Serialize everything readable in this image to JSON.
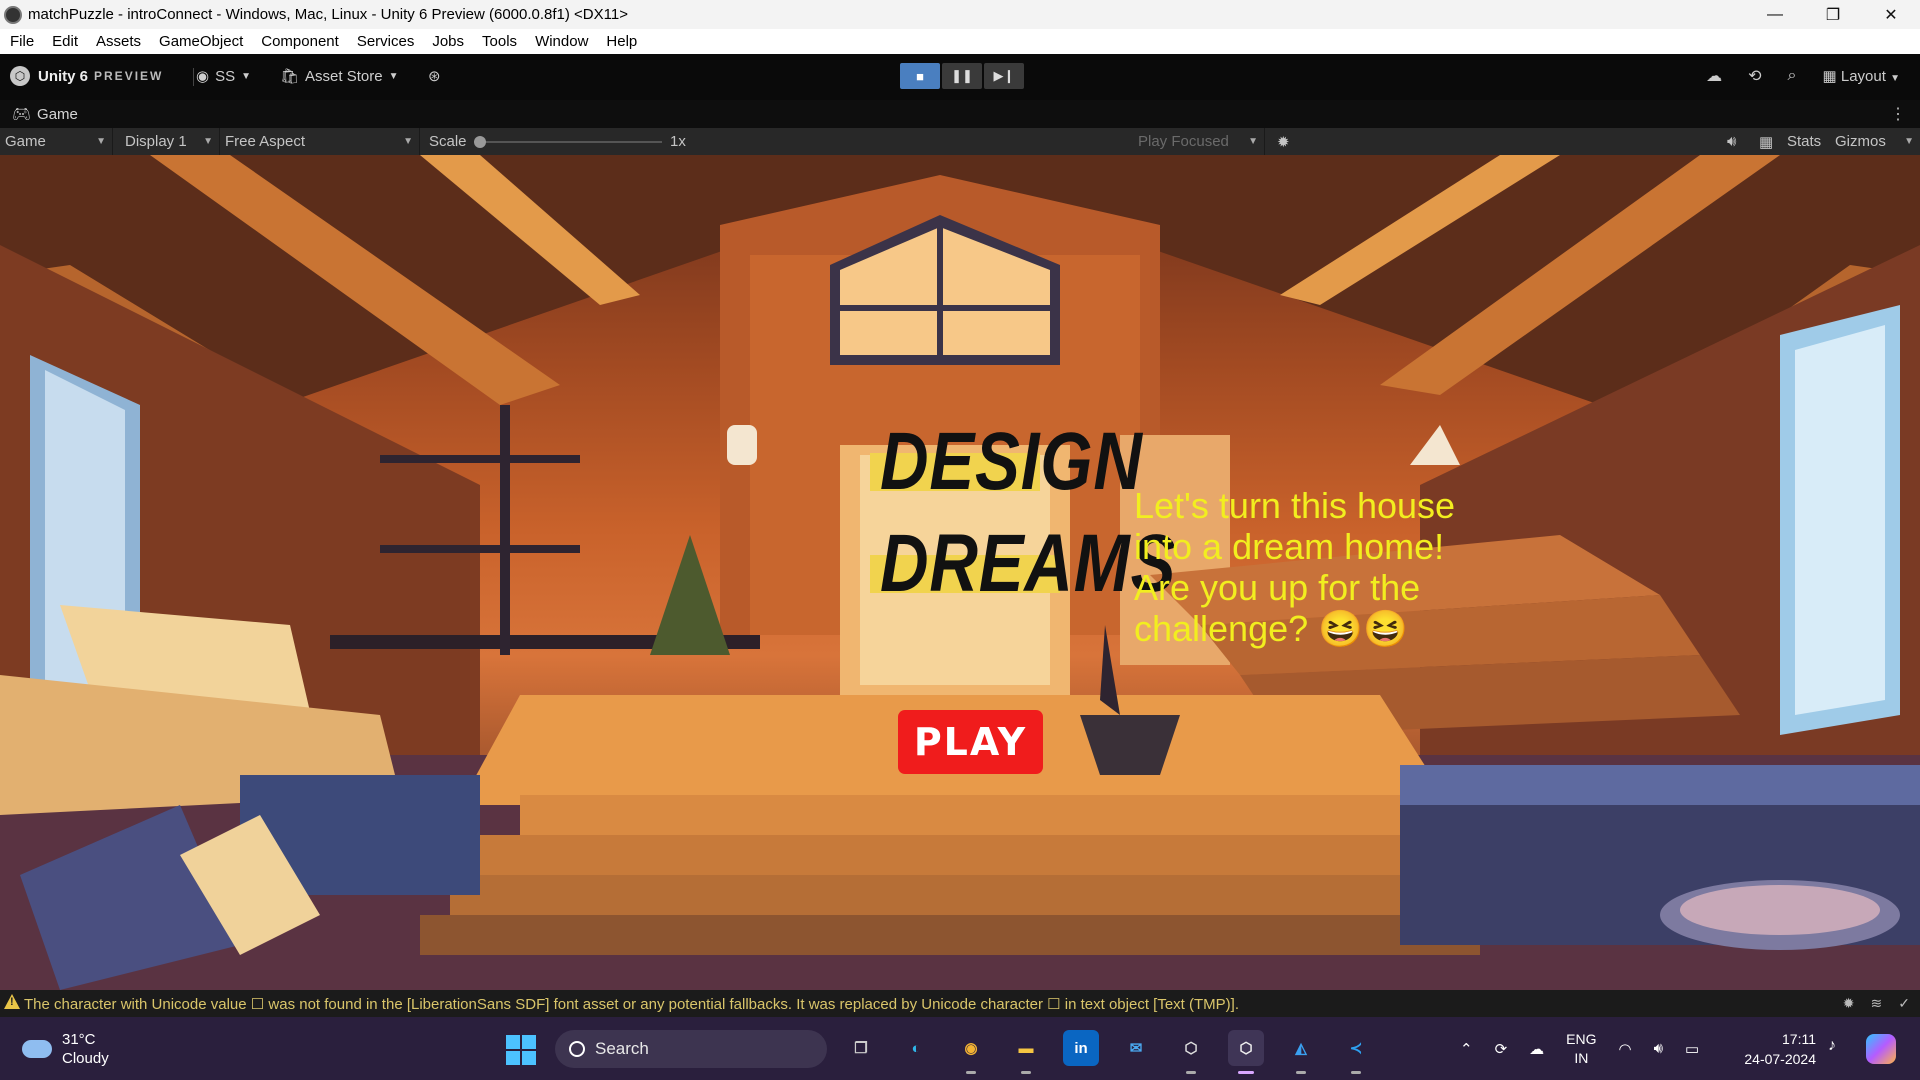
{
  "window": {
    "title": "matchPuzzle - introConnect - Windows, Mac, Linux - Unity 6 Preview (6000.0.8f1) <DX11>",
    "controls": [
      "—",
      "❐",
      "✕"
    ]
  },
  "menu": [
    "File",
    "Edit",
    "Assets",
    "GameObject",
    "Component",
    "Services",
    "Jobs",
    "Tools",
    "Window",
    "Help"
  ],
  "toolbar": {
    "brand": "Unity 6",
    "brand_suffix": "PREVIEW",
    "account": "SS",
    "asset_store": "Asset Store",
    "layout": "Layout"
  },
  "game_tab": {
    "label": "Game"
  },
  "game_toolbar": {
    "view": "Game",
    "display": "Display 1",
    "aspect": "Free Aspect",
    "scale_label": "Scale",
    "scale_value": "1x",
    "play_focused": "Play Focused",
    "stats": "Stats",
    "gizmos": "Gizmos"
  },
  "game": {
    "title_line1": "DESIGN",
    "title_line2": "DREAMS",
    "subtitle": "Let's turn this house into a dream home! Are you up for the challenge? 😆😆",
    "play_label": "PLAY",
    "colors": {
      "subtitle": "#f2ee1f",
      "play_bg": "#f01c1c",
      "title_highlight": "#f1d34e"
    }
  },
  "console": {
    "message": "The character with Unicode value ☐ was not found in the [LiberationSans SDF] font asset or any potential fallbacks. It was replaced by Unicode character ☐ in text object [Text (TMP)]."
  },
  "taskbar": {
    "weather_temp": "31°C",
    "weather_desc": "Cloudy",
    "search_placeholder": "Search",
    "lang_line1": "ENG",
    "lang_line2": "IN",
    "time": "17:11",
    "date": "24-07-2024",
    "apps": [
      "task-view-icon",
      "edge-icon",
      "chrome-icon",
      "file-explorer-icon",
      "linkedin-icon",
      "mail-icon",
      "unity-hub-icon",
      "unity-editor-icon",
      "azure-icon",
      "vscode-icon"
    ]
  }
}
